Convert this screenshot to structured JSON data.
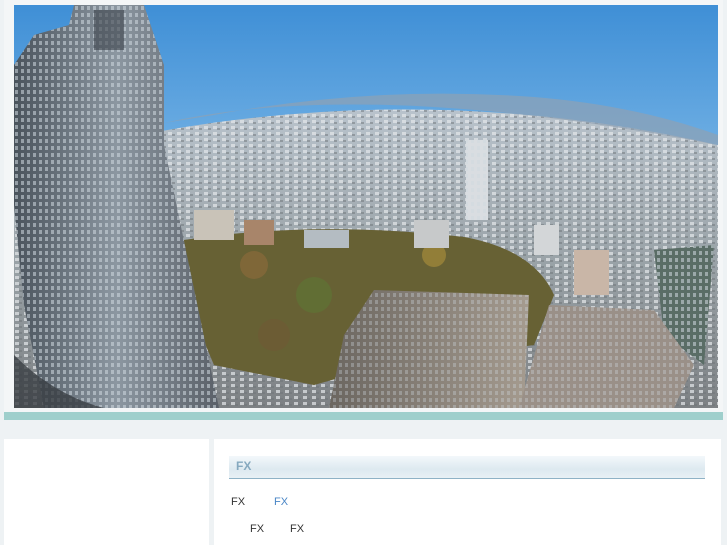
{
  "header": {
    "image_description": "fisheye-aerial-city-skyline"
  },
  "colors": {
    "accent_bar": "#9fcfcc",
    "section_title": "#86a9bf",
    "link_active": "#4a86c6",
    "text": "#333333"
  },
  "section": {
    "title": "FX"
  },
  "links": [
    {
      "label": "FX"
    },
    {
      "label": "FX"
    },
    {
      "label": "FX"
    },
    {
      "label": "FX"
    }
  ]
}
